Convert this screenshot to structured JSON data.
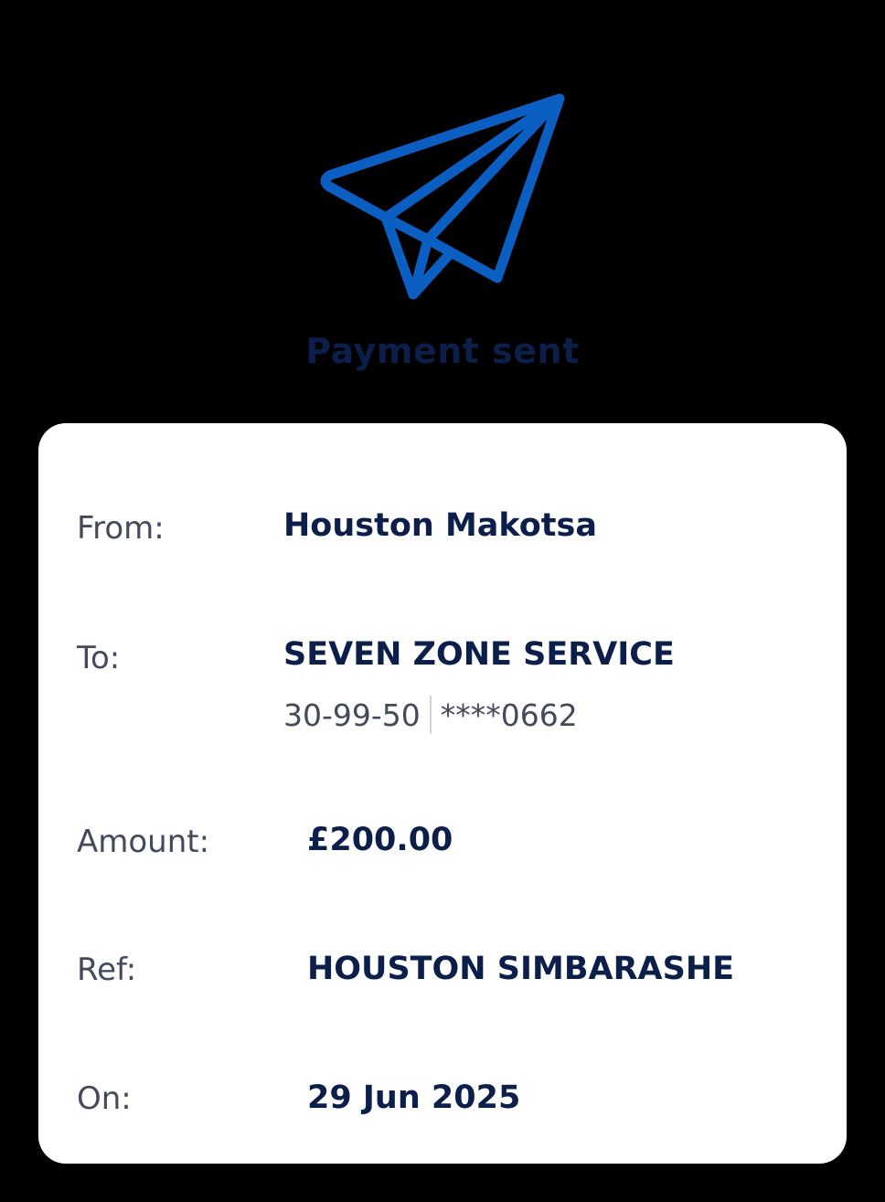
{
  "header": {
    "icon": "paper-plane-icon",
    "icon_color": "#0b5fc2",
    "title": "Payment sent",
    "title_color": "#0b1f4a"
  },
  "details": {
    "from": {
      "label": "From:",
      "value": "Houston Makotsa"
    },
    "to": {
      "label": "To:",
      "value": "SEVEN ZONE SERVICE",
      "sort_code": "30-99-50",
      "account": "****0662"
    },
    "amount": {
      "label": "Amount:",
      "value": "£200.00"
    },
    "ref": {
      "label": "Ref:",
      "value": "HOUSTON SIMBARASHE"
    },
    "on": {
      "label": "On:",
      "value": "29 Jun 2025"
    }
  }
}
